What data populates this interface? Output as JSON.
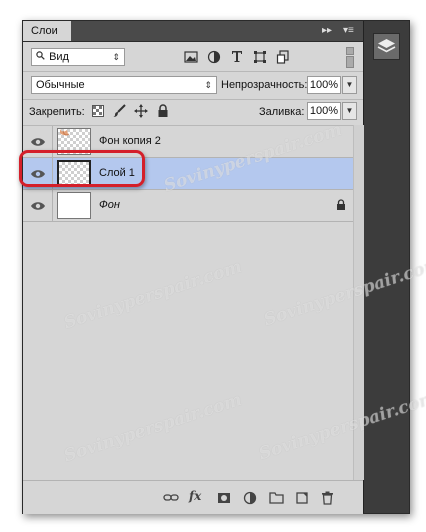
{
  "panel": {
    "tab_label": "Слои",
    "collapse_glyph": "▸▸",
    "menu_glyph": "▾≡"
  },
  "filter": {
    "kind_label": "Вид",
    "icons": [
      "image-filter-icon",
      "adjustment-filter-icon",
      "type-filter-icon",
      "shape-filter-icon",
      "smart-object-filter-icon"
    ]
  },
  "blend": {
    "mode": "Обычные",
    "opacity_label": "Непрозрачность:",
    "opacity_value": "100%"
  },
  "lock": {
    "label": "Закрепить:",
    "fill_label": "Заливка:",
    "fill_value": "100%"
  },
  "layers": [
    {
      "name": "Фон копия 2",
      "selected": false,
      "locked": false
    },
    {
      "name": "Слой 1",
      "selected": true,
      "locked": false
    },
    {
      "name": "Фон",
      "selected": false,
      "locked": true
    }
  ],
  "bottom_icons": [
    "link-layers-icon",
    "fx-icon",
    "add-mask-icon",
    "adjustment-layer-icon",
    "group-folder-icon",
    "new-layer-icon",
    "trash-icon"
  ],
  "watermark": "Sovinyperspair.com",
  "colors": {
    "panel_bg": "#d6d6d6",
    "selected_row": "#b4c8ee",
    "highlight": "#d41f2a",
    "frame": "#3c3c3c"
  }
}
